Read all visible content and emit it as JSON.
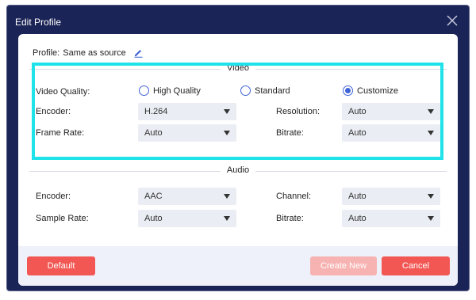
{
  "window": {
    "title": "Edit Profile",
    "close_icon": "close-icon"
  },
  "profile": {
    "label": "Profile:",
    "value": "Same as source",
    "edit_icon": "pencil-icon",
    "accent": "#3f63d6"
  },
  "video": {
    "heading": "Video",
    "quality_label": "Video Quality:",
    "quality_options": [
      {
        "label": "High Quality",
        "selected": false
      },
      {
        "label": "Standard",
        "selected": false
      },
      {
        "label": "Customize",
        "selected": true
      }
    ],
    "encoder_label": "Encoder:",
    "encoder_value": "H.264",
    "resolution_label": "Resolution:",
    "resolution_value": "Auto",
    "framerate_label": "Frame Rate:",
    "framerate_value": "Auto",
    "bitrate_label": "Bitrate:",
    "bitrate_value": "Auto"
  },
  "audio": {
    "heading": "Audio",
    "encoder_label": "Encoder:",
    "encoder_value": "AAC",
    "channel_label": "Channel:",
    "channel_value": "Auto",
    "samplerate_label": "Sample Rate:",
    "samplerate_value": "Auto",
    "bitrate_label": "Bitrate:",
    "bitrate_value": "Auto"
  },
  "buttons": {
    "default": "Default",
    "create_new": "Create New",
    "cancel": "Cancel"
  },
  "colors": {
    "titlebar": "#1b2456",
    "highlight": "#20e3e9",
    "button": "#f25754",
    "button_disabled": "#f6b3b2"
  }
}
